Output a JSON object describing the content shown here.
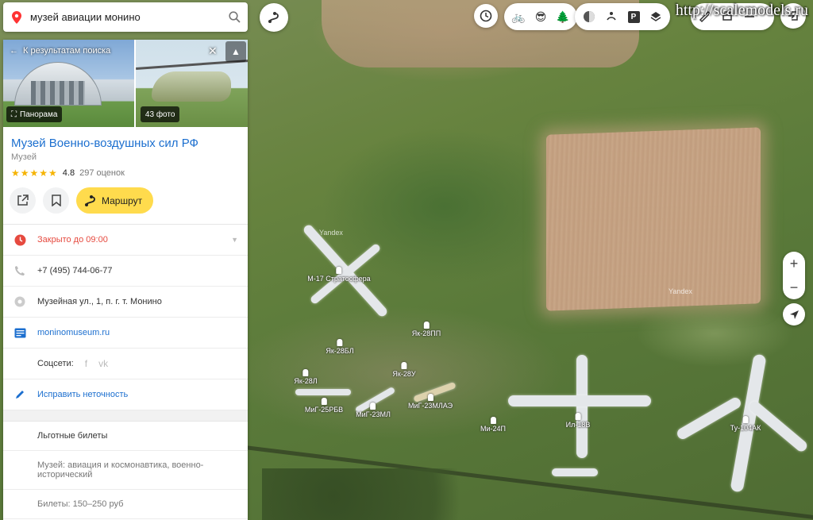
{
  "search": {
    "value": "музей авиации монино"
  },
  "watermark": "http://scalemodels.ru",
  "card": {
    "back_label": "К результатам поиска",
    "panorama_label": "Панорама",
    "photos_label": "43 фото",
    "title": "Музей Военно-воздушных сил РФ",
    "category": "Музей",
    "rating": {
      "stars": "★★★★★",
      "value": "4.8",
      "count": "297 оценок"
    },
    "route_label": "Маршрут",
    "hours": "Закрыто до 09:00",
    "phone": "+7 (495) 744-06-77",
    "address": "Музейная ул., 1, п. г. т. Монино",
    "website": "moninomuseum.ru",
    "social_label": "Соцсети:",
    "social": [
      "f",
      "vk"
    ],
    "edit_label": "Исправить неточность",
    "tickets_discount": "Льготные билеты",
    "museum_type": "Музей: авиация и космонавтика, военно-исторический",
    "tickets_price": "Билеты: 150–250 руб"
  },
  "map": {
    "yandex_label": "Yandex",
    "labels": [
      "М-17 Стратосфера",
      "Як-28ПП",
      "Як-28БЛ",
      "Як-28У",
      "Як-28Л",
      "МиГ-25РБВ",
      "МиГ-23МЛ",
      "МиГ-23МЛАЭ",
      "Ми-24П",
      "Ил-18В",
      "Ту-104АК"
    ]
  },
  "controls": {
    "parking_label": "P",
    "zoom_in": "+",
    "zoom_out": "−"
  }
}
